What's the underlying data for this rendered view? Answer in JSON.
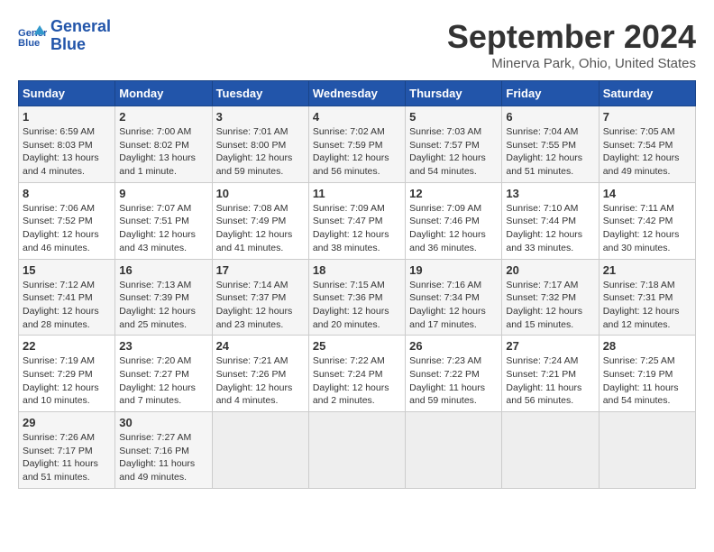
{
  "header": {
    "logo_line1": "General",
    "logo_line2": "Blue",
    "main_title": "September 2024",
    "subtitle": "Minerva Park, Ohio, United States"
  },
  "days_of_week": [
    "Sunday",
    "Monday",
    "Tuesday",
    "Wednesday",
    "Thursday",
    "Friday",
    "Saturday"
  ],
  "weeks": [
    [
      {
        "day": "1",
        "sunrise": "Sunrise: 6:59 AM",
        "sunset": "Sunset: 8:03 PM",
        "daylight": "Daylight: 13 hours and 4 minutes."
      },
      {
        "day": "2",
        "sunrise": "Sunrise: 7:00 AM",
        "sunset": "Sunset: 8:02 PM",
        "daylight": "Daylight: 13 hours and 1 minute."
      },
      {
        "day": "3",
        "sunrise": "Sunrise: 7:01 AM",
        "sunset": "Sunset: 8:00 PM",
        "daylight": "Daylight: 12 hours and 59 minutes."
      },
      {
        "day": "4",
        "sunrise": "Sunrise: 7:02 AM",
        "sunset": "Sunset: 7:59 PM",
        "daylight": "Daylight: 12 hours and 56 minutes."
      },
      {
        "day": "5",
        "sunrise": "Sunrise: 7:03 AM",
        "sunset": "Sunset: 7:57 PM",
        "daylight": "Daylight: 12 hours and 54 minutes."
      },
      {
        "day": "6",
        "sunrise": "Sunrise: 7:04 AM",
        "sunset": "Sunset: 7:55 PM",
        "daylight": "Daylight: 12 hours and 51 minutes."
      },
      {
        "day": "7",
        "sunrise": "Sunrise: 7:05 AM",
        "sunset": "Sunset: 7:54 PM",
        "daylight": "Daylight: 12 hours and 49 minutes."
      }
    ],
    [
      {
        "day": "8",
        "sunrise": "Sunrise: 7:06 AM",
        "sunset": "Sunset: 7:52 PM",
        "daylight": "Daylight: 12 hours and 46 minutes."
      },
      {
        "day": "9",
        "sunrise": "Sunrise: 7:07 AM",
        "sunset": "Sunset: 7:51 PM",
        "daylight": "Daylight: 12 hours and 43 minutes."
      },
      {
        "day": "10",
        "sunrise": "Sunrise: 7:08 AM",
        "sunset": "Sunset: 7:49 PM",
        "daylight": "Daylight: 12 hours and 41 minutes."
      },
      {
        "day": "11",
        "sunrise": "Sunrise: 7:09 AM",
        "sunset": "Sunset: 7:47 PM",
        "daylight": "Daylight: 12 hours and 38 minutes."
      },
      {
        "day": "12",
        "sunrise": "Sunrise: 7:09 AM",
        "sunset": "Sunset: 7:46 PM",
        "daylight": "Daylight: 12 hours and 36 minutes."
      },
      {
        "day": "13",
        "sunrise": "Sunrise: 7:10 AM",
        "sunset": "Sunset: 7:44 PM",
        "daylight": "Daylight: 12 hours and 33 minutes."
      },
      {
        "day": "14",
        "sunrise": "Sunrise: 7:11 AM",
        "sunset": "Sunset: 7:42 PM",
        "daylight": "Daylight: 12 hours and 30 minutes."
      }
    ],
    [
      {
        "day": "15",
        "sunrise": "Sunrise: 7:12 AM",
        "sunset": "Sunset: 7:41 PM",
        "daylight": "Daylight: 12 hours and 28 minutes."
      },
      {
        "day": "16",
        "sunrise": "Sunrise: 7:13 AM",
        "sunset": "Sunset: 7:39 PM",
        "daylight": "Daylight: 12 hours and 25 minutes."
      },
      {
        "day": "17",
        "sunrise": "Sunrise: 7:14 AM",
        "sunset": "Sunset: 7:37 PM",
        "daylight": "Daylight: 12 hours and 23 minutes."
      },
      {
        "day": "18",
        "sunrise": "Sunrise: 7:15 AM",
        "sunset": "Sunset: 7:36 PM",
        "daylight": "Daylight: 12 hours and 20 minutes."
      },
      {
        "day": "19",
        "sunrise": "Sunrise: 7:16 AM",
        "sunset": "Sunset: 7:34 PM",
        "daylight": "Daylight: 12 hours and 17 minutes."
      },
      {
        "day": "20",
        "sunrise": "Sunrise: 7:17 AM",
        "sunset": "Sunset: 7:32 PM",
        "daylight": "Daylight: 12 hours and 15 minutes."
      },
      {
        "day": "21",
        "sunrise": "Sunrise: 7:18 AM",
        "sunset": "Sunset: 7:31 PM",
        "daylight": "Daylight: 12 hours and 12 minutes."
      }
    ],
    [
      {
        "day": "22",
        "sunrise": "Sunrise: 7:19 AM",
        "sunset": "Sunset: 7:29 PM",
        "daylight": "Daylight: 12 hours and 10 minutes."
      },
      {
        "day": "23",
        "sunrise": "Sunrise: 7:20 AM",
        "sunset": "Sunset: 7:27 PM",
        "daylight": "Daylight: 12 hours and 7 minutes."
      },
      {
        "day": "24",
        "sunrise": "Sunrise: 7:21 AM",
        "sunset": "Sunset: 7:26 PM",
        "daylight": "Daylight: 12 hours and 4 minutes."
      },
      {
        "day": "25",
        "sunrise": "Sunrise: 7:22 AM",
        "sunset": "Sunset: 7:24 PM",
        "daylight": "Daylight: 12 hours and 2 minutes."
      },
      {
        "day": "26",
        "sunrise": "Sunrise: 7:23 AM",
        "sunset": "Sunset: 7:22 PM",
        "daylight": "Daylight: 11 hours and 59 minutes."
      },
      {
        "day": "27",
        "sunrise": "Sunrise: 7:24 AM",
        "sunset": "Sunset: 7:21 PM",
        "daylight": "Daylight: 11 hours and 56 minutes."
      },
      {
        "day": "28",
        "sunrise": "Sunrise: 7:25 AM",
        "sunset": "Sunset: 7:19 PM",
        "daylight": "Daylight: 11 hours and 54 minutes."
      }
    ],
    [
      {
        "day": "29",
        "sunrise": "Sunrise: 7:26 AM",
        "sunset": "Sunset: 7:17 PM",
        "daylight": "Daylight: 11 hours and 51 minutes."
      },
      {
        "day": "30",
        "sunrise": "Sunrise: 7:27 AM",
        "sunset": "Sunset: 7:16 PM",
        "daylight": "Daylight: 11 hours and 49 minutes."
      },
      null,
      null,
      null,
      null,
      null
    ]
  ]
}
